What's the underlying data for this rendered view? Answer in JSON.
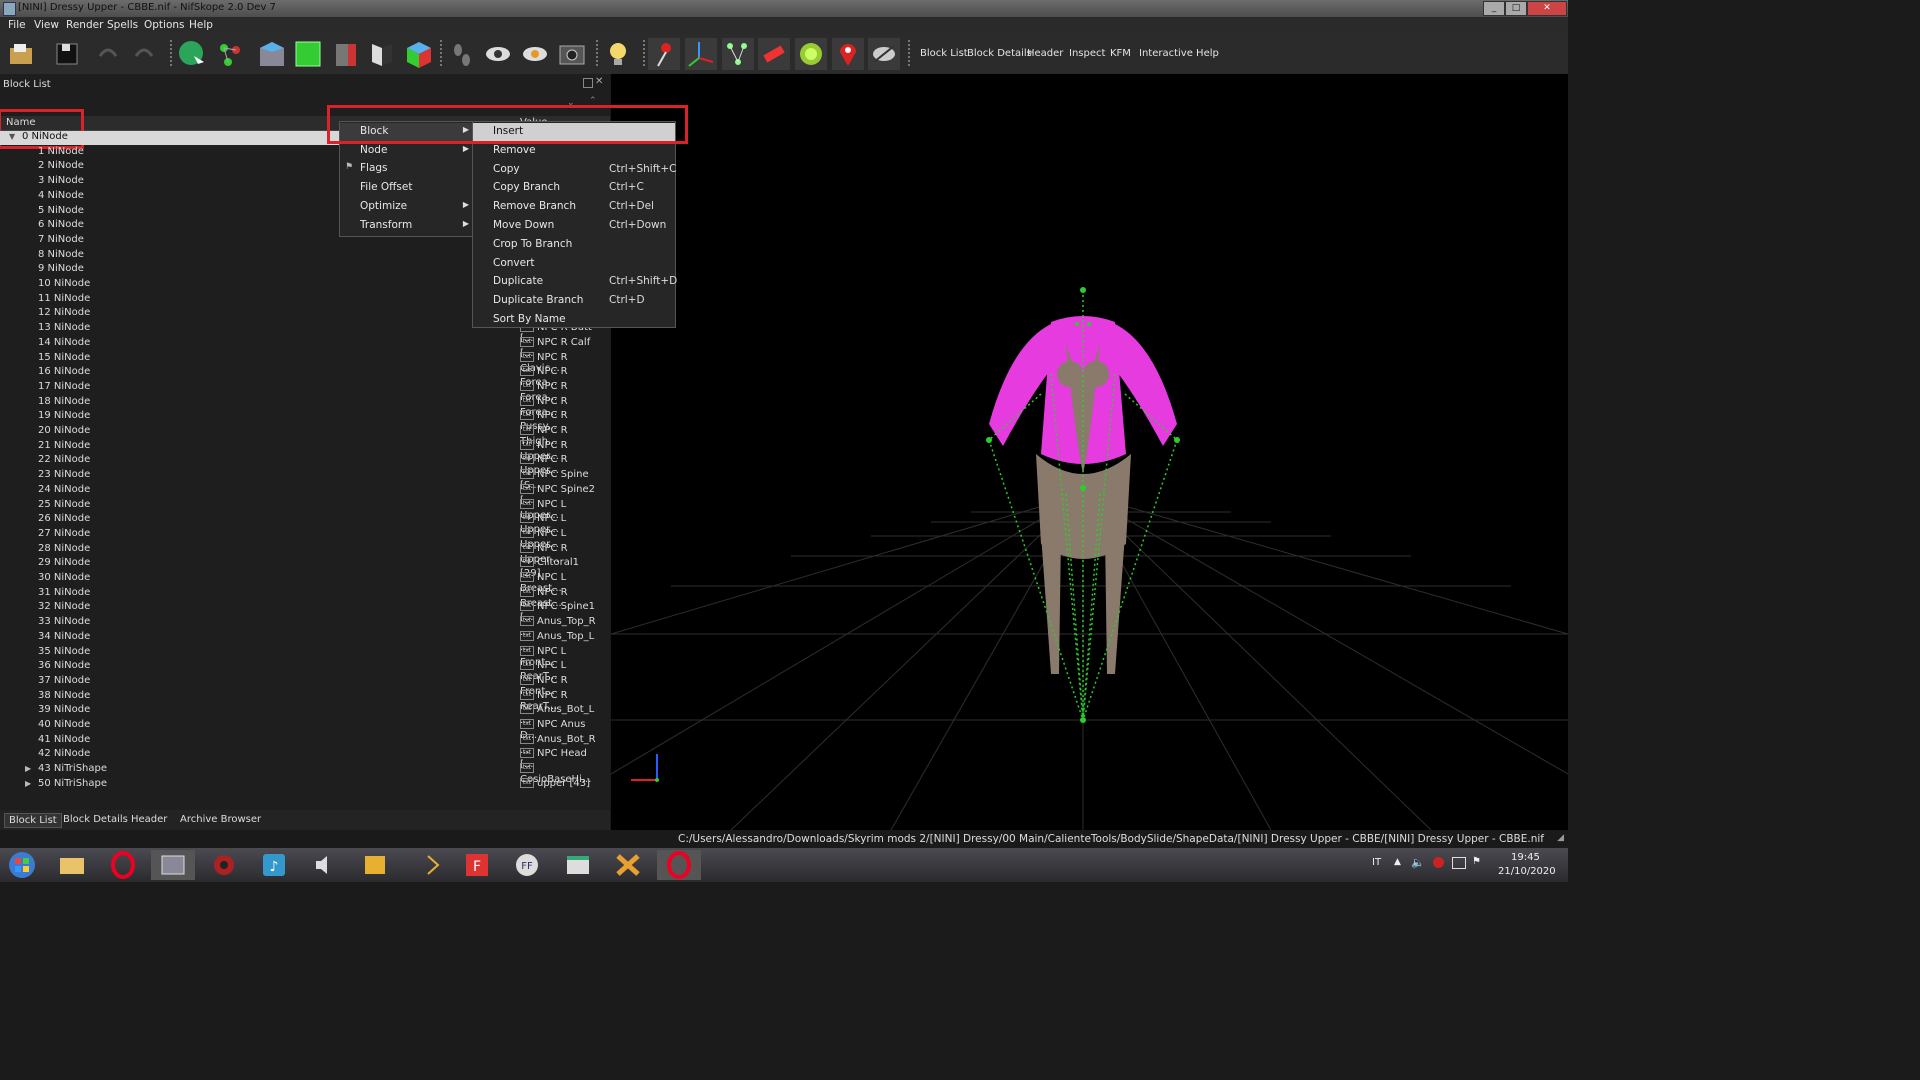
{
  "window": {
    "title": "[NINI] Dressy Upper - CBBE.nif - NifSkope 2.0 Dev 7"
  },
  "menubar": [
    "File",
    "View",
    "Render",
    "Spells",
    "Options",
    "Help"
  ],
  "toolbar": {
    "text_buttons": [
      "Block List",
      "Block Details",
      "Header",
      "Inspect",
      "KFM",
      "Interactive Help"
    ]
  },
  "block_list": {
    "title": "Block List",
    "col_name": "Name",
    "col_value": "Value",
    "rows": [
      {
        "name": "0 NiNode",
        "value": ""
      },
      {
        "name": "1 NiNode",
        "value": ""
      },
      {
        "name": "2 NiNode",
        "value": ""
      },
      {
        "name": "3 NiNode",
        "value": ""
      },
      {
        "name": "4 NiNode",
        "value": ""
      },
      {
        "name": "5 NiNode",
        "value": ""
      },
      {
        "name": "6 NiNode",
        "value": ""
      },
      {
        "name": "7 NiNode",
        "value": ""
      },
      {
        "name": "8 NiNode",
        "value": ""
      },
      {
        "name": "9 NiNode",
        "value": ""
      },
      {
        "name": "10 NiNode",
        "value": ""
      },
      {
        "name": "11 NiNode",
        "value": ""
      },
      {
        "name": "12 NiNode",
        "value": ""
      },
      {
        "name": "13 NiNode",
        "value": "NPC R Butt [..."
      },
      {
        "name": "14 NiNode",
        "value": "NPC R Calf [..."
      },
      {
        "name": "15 NiNode",
        "value": "NPC R Clavic..."
      },
      {
        "name": "16 NiNode",
        "value": "NPC R Forea..."
      },
      {
        "name": "17 NiNode",
        "value": "NPC R Forea..."
      },
      {
        "name": "18 NiNode",
        "value": "NPC R Forea..."
      },
      {
        "name": "19 NiNode",
        "value": "NPC R Pussy..."
      },
      {
        "name": "20 NiNode",
        "value": "NPC R Thigh..."
      },
      {
        "name": "21 NiNode",
        "value": "NPC R Upper..."
      },
      {
        "name": "22 NiNode",
        "value": "NPC R Upper..."
      },
      {
        "name": "23 NiNode",
        "value": "NPC Spine [S..."
      },
      {
        "name": "24 NiNode",
        "value": "NPC Spine2 [..."
      },
      {
        "name": "25 NiNode",
        "value": "NPC L Upper..."
      },
      {
        "name": "26 NiNode",
        "value": "NPC L Upper..."
      },
      {
        "name": "27 NiNode",
        "value": "NPC L Upper..."
      },
      {
        "name": "28 NiNode",
        "value": "NPC R Upper..."
      },
      {
        "name": "29 NiNode",
        "value": "Clitoral1 [29]"
      },
      {
        "name": "30 NiNode",
        "value": "NPC L Breast..."
      },
      {
        "name": "31 NiNode",
        "value": "NPC R Breast..."
      },
      {
        "name": "32 NiNode",
        "value": "NPC Spine1 [..."
      },
      {
        "name": "33 NiNode",
        "value": "Anus_Top_R ..."
      },
      {
        "name": "34 NiNode",
        "value": "Anus_Top_L ..."
      },
      {
        "name": "35 NiNode",
        "value": "NPC L Front..."
      },
      {
        "name": "36 NiNode",
        "value": "NPC L RearT..."
      },
      {
        "name": "37 NiNode",
        "value": "NPC R Front..."
      },
      {
        "name": "38 NiNode",
        "value": "NPC R RearT..."
      },
      {
        "name": "39 NiNode",
        "value": "Anus_Bot_L ..."
      },
      {
        "name": "40 NiNode",
        "value": "NPC Anus D..."
      },
      {
        "name": "41 NiNode",
        "value": "Anus_Bot_R ..."
      },
      {
        "name": "42 NiNode",
        "value": "NPC Head [..."
      },
      {
        "name": "43 NiTriShape",
        "value": "CosioBaseHi..."
      },
      {
        "name": "50 NiTriShape",
        "value": "upper [43]"
      }
    ]
  },
  "bottom_tabs": [
    "Block List",
    "Block Details",
    "Header",
    "Archive Browser"
  ],
  "context_menu": [
    {
      "label": "Block",
      "submenu": true
    },
    {
      "label": "Node",
      "submenu": true
    },
    {
      "label": "Flags",
      "submenu": false
    },
    {
      "label": "File Offset",
      "submenu": false
    },
    {
      "label": "Optimize",
      "submenu": true
    },
    {
      "label": "Transform",
      "submenu": true
    }
  ],
  "block_submenu": [
    {
      "label": "Insert",
      "shortcut": ""
    },
    {
      "label": "Remove",
      "shortcut": ""
    },
    {
      "label": "Copy",
      "shortcut": "Ctrl+Shift+C"
    },
    {
      "label": "Copy Branch",
      "shortcut": "Ctrl+C"
    },
    {
      "label": "Remove Branch",
      "shortcut": "Ctrl+Del"
    },
    {
      "label": "Move Down",
      "shortcut": "Ctrl+Down"
    },
    {
      "label": "Crop To Branch",
      "shortcut": ""
    },
    {
      "label": "Convert",
      "shortcut": ""
    },
    {
      "label": "Duplicate",
      "shortcut": "Ctrl+Shift+D"
    },
    {
      "label": "Duplicate Branch",
      "shortcut": "Ctrl+D"
    },
    {
      "label": "Sort By Name",
      "shortcut": ""
    }
  ],
  "status": {
    "path": "C:/Users/Alessandro/Downloads/Skyrim mods 2/[NINI] Dressy/00 Main/CalienteTools/BodySlide/ShapeData/[NINI] Dressy Upper - CBBE/[NINI] Dressy Upper - CBBE.nif"
  },
  "taskbar": {
    "lang": "IT",
    "time": "19:45",
    "date": "21/10/2020"
  }
}
